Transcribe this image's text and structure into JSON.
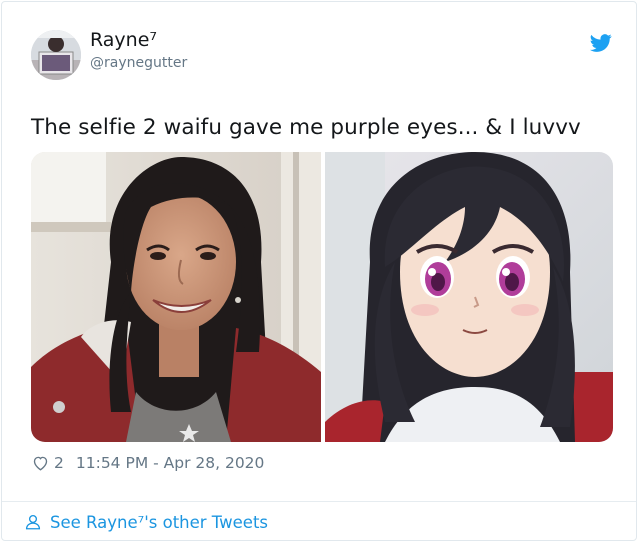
{
  "tweet": {
    "author_name": "Rayne⁷",
    "author_handle": "@raynegutter",
    "text": "The selfie 2 waifu gave me purple eyes... & I luvvv",
    "like_count": "2",
    "timestamp": "11:54 PM - Apr 28, 2020"
  },
  "footer": {
    "see_more_label": "See Rayne⁷'s other Tweets"
  },
  "icons": {
    "brand": "twitter-bird-icon",
    "like": "heart-outline-icon",
    "profile": "person-icon"
  },
  "colors": {
    "twitter_blue": "#1da1f2",
    "link_blue": "#1b95e0",
    "secondary_text": "#657786"
  }
}
